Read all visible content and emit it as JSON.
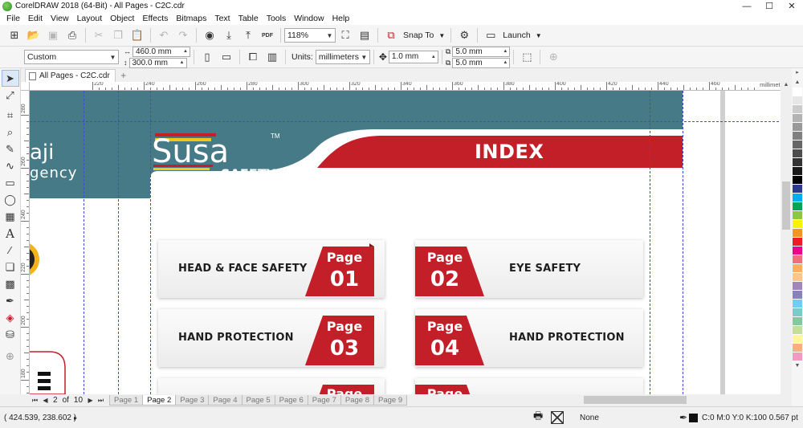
{
  "window": {
    "title": "CorelDRAW 2018 (64-Bit) - All Pages - C2C.cdr",
    "min_glyph": "—",
    "max_glyph": "☐",
    "close_glyph": "✕"
  },
  "menu": [
    "File",
    "Edit",
    "View",
    "Layout",
    "Object",
    "Effects",
    "Bitmaps",
    "Text",
    "Table",
    "Tools",
    "Window",
    "Help"
  ],
  "standard_toolbar": {
    "zoom": "118%",
    "snap_to": "Snap To",
    "launch": "Launch",
    "pdf_label": "PDF"
  },
  "property_bar": {
    "page_preset": "Custom",
    "width": "460.0 mm",
    "height": "300.0 mm",
    "units_label": "Units:",
    "units": "millimeters",
    "nudge": "1.0 mm",
    "dup_x": "5.0 mm",
    "dup_y": "5.0 mm"
  },
  "doc_tab": {
    "label": "All Pages - C2C.cdr",
    "add": "+"
  },
  "ruler": {
    "unit": "millimeters",
    "h_numbers": [
      "220",
      "240",
      "260",
      "280",
      "300",
      "320",
      "340",
      "360",
      "380",
      "400",
      "420",
      "440",
      "460"
    ],
    "v_numbers": [
      "280",
      "260",
      "240",
      "220",
      "200",
      "180"
    ]
  },
  "page_content": {
    "brand_partial_1": "aji",
    "brand_partial_2": "gency",
    "logo_word": "Susa",
    "logo_sub": "SAFETY",
    "logo_tm": "TM",
    "index_title": "INDEX",
    "rows": [
      {
        "left": {
          "title": "HEAD & FACE SAFETY",
          "page_word": "Page",
          "num": "01"
        },
        "right": {
          "title": "EYE SAFETY",
          "page_word": "Page",
          "num": "02"
        }
      },
      {
        "left": {
          "title": "HAND PROTECTION",
          "page_word": "Page",
          "num": "03"
        },
        "right": {
          "title": "HAND PROTECTION",
          "page_word": "Page",
          "num": "04"
        }
      },
      {
        "left": {
          "title": "",
          "page_word": "Page",
          "num": ""
        },
        "right": {
          "title": "",
          "page_word": "Page",
          "num": ""
        }
      }
    ],
    "colors": {
      "teal": "#467a86",
      "red": "#c31f28",
      "yellow": "#f2c619"
    }
  },
  "page_nav": {
    "current": "2",
    "of": "of",
    "total": "10",
    "tabs": [
      "Page 1",
      "Page 2",
      "Page 3",
      "Page 4",
      "Page 5",
      "Page 6",
      "Page 7",
      "Page 8",
      "Page 9"
    ],
    "active_index": 1
  },
  "palette": [
    "#ffffff",
    "#e6e6e6",
    "#cccccc",
    "#b3b3b3",
    "#999999",
    "#808080",
    "#666666",
    "#4d4d4d",
    "#333333",
    "#1a1a1a",
    "#000000",
    "#2b3990",
    "#00aeef",
    "#00a651",
    "#8dc63f",
    "#fff200",
    "#f7941d",
    "#ed1c24",
    "#ec008c",
    "#f26d7d",
    "#fbaf5d",
    "#fdc689",
    "#a186be",
    "#8781bd",
    "#6dcff6",
    "#7accc8",
    "#82ca9c",
    "#c4df9b",
    "#fff799",
    "#f9ad81",
    "#f49ac1"
  ],
  "status": {
    "coords": "( 424.539, 238.602 )",
    "arrow": "▸",
    "fill": "None",
    "outline": "C:0 M:0 Y:0 K:100  0.567 pt"
  }
}
